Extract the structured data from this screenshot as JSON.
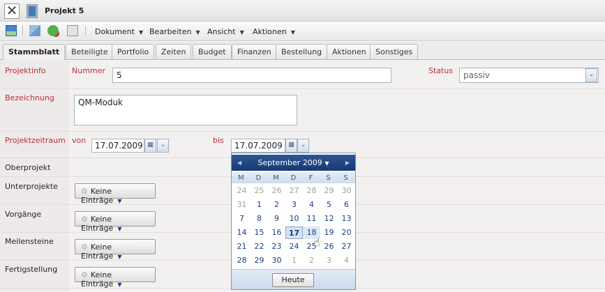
{
  "window": {
    "title": "Projekt 5"
  },
  "toolbar": {
    "menus": [
      "Dokument",
      "Bearbeiten",
      "Ansicht",
      "Aktionen"
    ]
  },
  "tabs": [
    "Stammblatt",
    "Beteiligte",
    "Portfolio",
    "Zeiten",
    "Budget",
    "Finanzen",
    "Bestellung",
    "Aktionen",
    "Sonstiges"
  ],
  "form": {
    "projektinfo": "Projektinfo",
    "nummer_label": "Nummer",
    "nummer": "5",
    "status_label": "Status",
    "status": "passiv",
    "bezeichnung_label": "Bezeichnung",
    "bezeichnung": "QM-Moduk",
    "zeitraum_label": "Projektzeitraum",
    "von_label": "von",
    "von": "17.07.2009",
    "bis_label": "bis",
    "bis": "17.07.2009",
    "oberprojekt": "Oberprojekt",
    "lists": [
      {
        "label": "Unterprojekte",
        "button": "Keine Einträge"
      },
      {
        "label": "Vorgänge",
        "button": "Keine Einträge"
      },
      {
        "label": "Meilensteine",
        "button": "Keine Einträge"
      },
      {
        "label": "Fertigstellung",
        "button": "Keine Einträge"
      }
    ]
  },
  "calendar": {
    "month": "September 2009",
    "weekdays": [
      "M",
      "D",
      "M",
      "D",
      "F",
      "S",
      "S"
    ],
    "weeks": [
      [
        "24",
        "25",
        "26",
        "27",
        "28",
        "29",
        "30"
      ],
      [
        "31",
        "1",
        "2",
        "3",
        "4",
        "5",
        "6"
      ],
      [
        "7",
        "8",
        "9",
        "10",
        "11",
        "12",
        "13"
      ],
      [
        "14",
        "15",
        "16",
        "17",
        "18",
        "19",
        "20"
      ],
      [
        "21",
        "22",
        "23",
        "24",
        "25",
        "26",
        "27"
      ],
      [
        "28",
        "29",
        "30",
        "1",
        "2",
        "3",
        "4"
      ]
    ],
    "selected": "17",
    "hovered": "18",
    "today_label": "Heute"
  }
}
